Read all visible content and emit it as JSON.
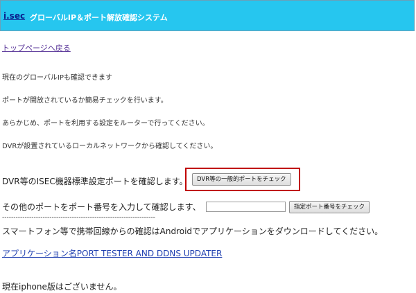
{
  "header": {
    "brand": "i.sec",
    "title": "グローバルIP＆ポート解放確認システム"
  },
  "nav": {
    "top_link": "トップページへ戻る"
  },
  "intro": {
    "line1": "現在のグローバルIPも確認できます",
    "line2": "ポートが開放されているか簡易チェックを行います。",
    "line3": "あらかじめ、ポートを利用する設定をルーターで行ってください。",
    "line4": "DVRが設置されているローカルネットワークから確認してください。"
  },
  "dvr_check": {
    "label": "DVR等のISEC機器標準設定ポートを確認します。",
    "button": "DVR等の一般的ポートをチェック"
  },
  "custom_check": {
    "label": "その他のポートをポート番号を入力して確認します、",
    "input_value": "",
    "button": "指定ポート番号をチェック"
  },
  "divider": "--------------------------------------------------------------------",
  "smartphone": {
    "note": "スマートフォン等で携帯回線からの確認はAndroidでアプリケーションをダウンロードしてください。",
    "app_link": "アプリケーション名PORT TESTER AND DDNS UPDATER",
    "iphone_note": "現在iphone版はございません。"
  }
}
